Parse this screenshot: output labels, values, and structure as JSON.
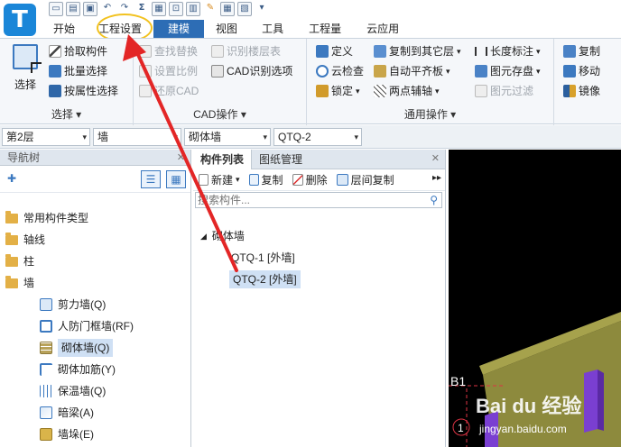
{
  "app": {
    "logo_letter": "T"
  },
  "tabs": [
    {
      "label": "开始",
      "active": false
    },
    {
      "label": "工程设置",
      "active": false
    },
    {
      "label": "建模",
      "active": true
    },
    {
      "label": "视图",
      "active": false
    },
    {
      "label": "工具",
      "active": false
    },
    {
      "label": "工程量",
      "active": false
    },
    {
      "label": "云应用",
      "active": false
    }
  ],
  "ribbon": {
    "select_group": {
      "title": "选择",
      "big_button": "选择",
      "buttons": [
        "拾取构件",
        "批量选择",
        "按属性选择"
      ]
    },
    "cad_group": {
      "title": "CAD操作",
      "buttons": [
        "查找替换",
        "识别楼层表",
        "设置比例",
        "CAD识别选项",
        "还原CAD"
      ]
    },
    "general_group": {
      "title": "通用操作",
      "buttons": [
        "定义",
        "复制到其它层",
        "长度标注",
        "云检查",
        "自动平齐板",
        "图元存盘",
        "锁定",
        "两点辅轴",
        "图元过滤"
      ]
    },
    "edit_group": {
      "buttons": [
        "复制",
        "移动",
        "镜像"
      ]
    }
  },
  "selectors": [
    "第2层",
    "墙",
    "砌体墙",
    "QTQ-2"
  ],
  "nav": {
    "title": "导航树",
    "categories": [
      {
        "label": "常用构件类型"
      },
      {
        "label": "轴线"
      },
      {
        "label": "柱"
      },
      {
        "label": "墙"
      }
    ],
    "wall_children": [
      {
        "label": "剪力墙(Q)",
        "selected": false
      },
      {
        "label": "人防门框墙(RF)",
        "selected": false
      },
      {
        "label": "砌体墙(Q)",
        "selected": true
      },
      {
        "label": "砌体加筋(Y)",
        "selected": false
      },
      {
        "label": "保温墙(Q)",
        "selected": false
      },
      {
        "label": "暗梁(A)",
        "selected": false
      },
      {
        "label": "墙垛(E)",
        "selected": false
      }
    ]
  },
  "component_list": {
    "tabs": [
      "构件列表",
      "图纸管理"
    ],
    "tools": [
      "新建",
      "复制",
      "删除",
      "层间复制"
    ],
    "search_placeholder": "搜索构件...",
    "group_label": "砌体墙",
    "items": [
      {
        "label": "QTQ-1 [外墙]",
        "selected": false
      },
      {
        "label": "QTQ-2 [外墙]",
        "selected": true
      }
    ]
  },
  "view3d": {
    "axis_label_b1": "B1",
    "axis_label_1": "1",
    "watermark": "Bai du 经验",
    "watermark_url": "jingyan.baidu.com"
  },
  "colors": {
    "accent": "#2d6db5",
    "highlight_ring": "#f2c21f",
    "arrow": "#e32626",
    "wall_fill": "#8d8a3d",
    "column_fill": "#7a3fd1"
  }
}
